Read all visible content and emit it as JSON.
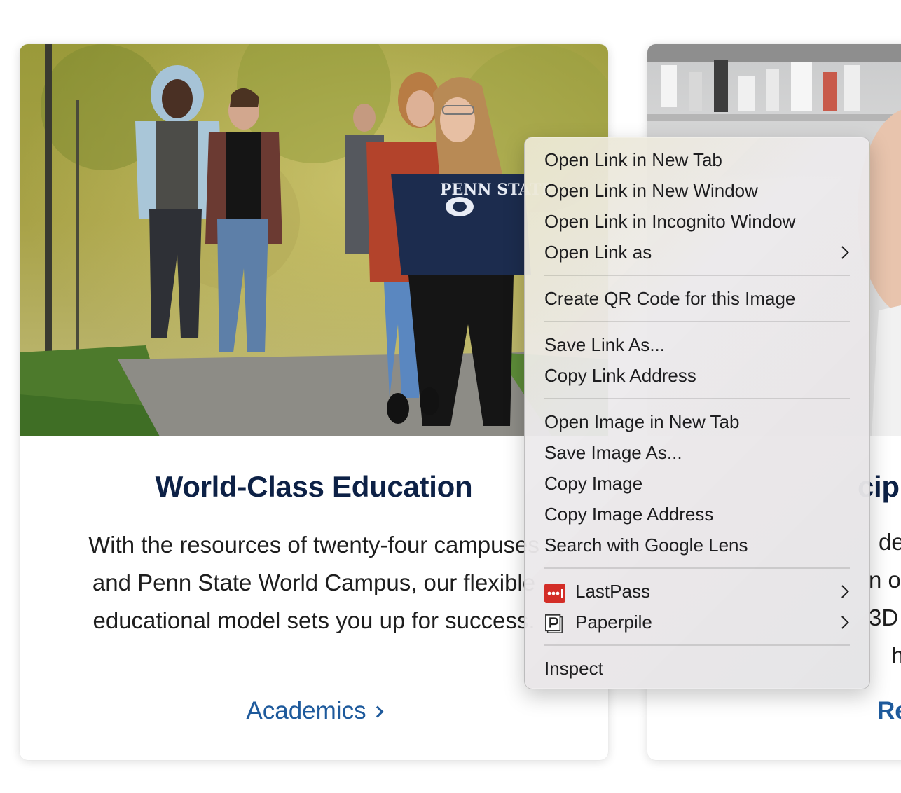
{
  "cards": [
    {
      "title": "World-Class Education",
      "body_lines": [
        "With the resources of twenty-four campuses",
        "and Penn State World Campus, our flexible",
        "educational model sets you up for success."
      ],
      "link_label": "Academics"
    },
    {
      "title_fragment": "cip",
      "body_fragments": [
        "der",
        "n or",
        "3D",
        "h"
      ],
      "link_fragment": "Re"
    }
  ],
  "photo": {
    "sweatshirt_text": "PENN STATE"
  },
  "context_menu": {
    "groups": [
      [
        {
          "label": "Open Link in New Tab"
        },
        {
          "label": "Open Link in New Window"
        },
        {
          "label": "Open Link in Incognito Window"
        },
        {
          "label": "Open Link as",
          "submenu": true
        }
      ],
      [
        {
          "label": "Create QR Code for this Image"
        }
      ],
      [
        {
          "label": "Save Link As..."
        },
        {
          "label": "Copy Link Address"
        }
      ],
      [
        {
          "label": "Open Image in New Tab"
        },
        {
          "label": "Save Image As..."
        },
        {
          "label": "Copy Image"
        },
        {
          "label": "Copy Image Address"
        },
        {
          "label": "Search with Google Lens"
        }
      ],
      [
        {
          "label": "LastPass",
          "submenu": true,
          "icon": "lastpass-icon"
        },
        {
          "label": "Paperpile",
          "submenu": true,
          "icon": "paperpile-icon"
        }
      ],
      [
        {
          "label": "Inspect"
        }
      ]
    ]
  },
  "colors": {
    "title": "#0d2146",
    "link": "#1e5a9c",
    "lastpass_red": "#d32d27"
  }
}
